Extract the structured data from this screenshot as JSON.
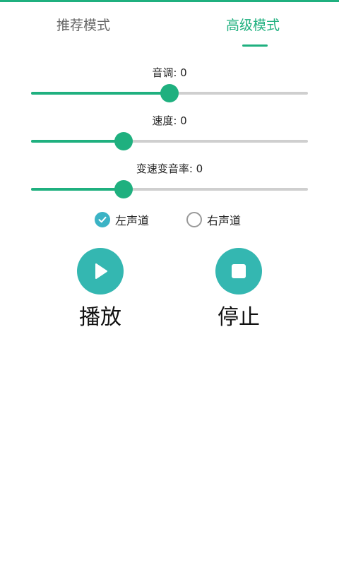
{
  "tabs": {
    "recommend": "推荐模式",
    "advanced": "高级模式",
    "active": "advanced"
  },
  "sliders": [
    {
      "label": "音调: 0",
      "value": 0.5
    },
    {
      "label": "速度: 0",
      "value": 0.335
    },
    {
      "label": "变速变音率: 0",
      "value": 0.335
    }
  ],
  "channels": {
    "left": {
      "label": "左声道",
      "checked": true
    },
    "right": {
      "label": "右声道",
      "checked": false
    }
  },
  "controls": {
    "play_label": "播放",
    "stop_label": "停止"
  },
  "colors": {
    "accent": "#1fb07f",
    "button": "#34b7b1",
    "radio_checked": "#3bb3c5"
  },
  "icons": {
    "play": "play-icon",
    "stop": "stop-icon",
    "check": "check-icon"
  }
}
